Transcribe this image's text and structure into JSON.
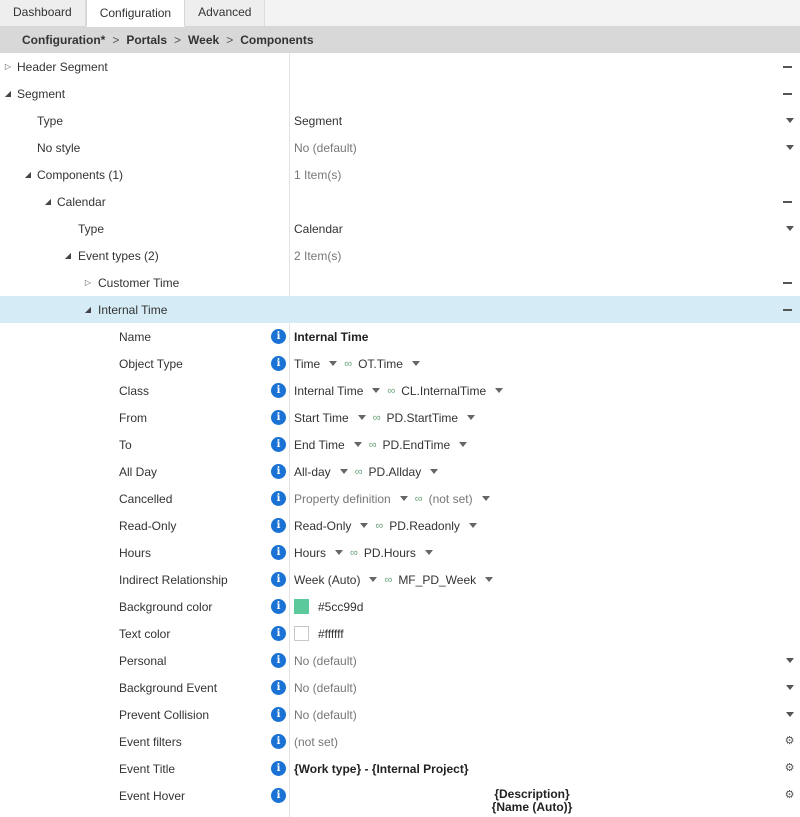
{
  "tabs": [
    {
      "label": "Dashboard"
    },
    {
      "label": "Configuration"
    },
    {
      "label": "Advanced"
    }
  ],
  "breadcrumb": [
    "Configuration*",
    "Portals",
    "Week",
    "Components"
  ],
  "breadcrumb_sep": ">",
  "tree": {
    "header_segment": "Header Segment",
    "segment": "Segment",
    "segment_type": {
      "label": "Type",
      "value": "Segment"
    },
    "no_style": {
      "label": "No style",
      "value": "No (default)"
    },
    "components": {
      "label": "Components (1)",
      "value": "1 Item(s)"
    },
    "calendar": "Calendar",
    "calendar_type": {
      "label": "Type",
      "value": "Calendar"
    },
    "event_types": {
      "label": "Event types (2)",
      "value": "2 Item(s)"
    },
    "customer_time": "Customer Time",
    "internal_time": "Internal Time"
  },
  "props": {
    "name": {
      "label": "Name",
      "value": "Internal Time"
    },
    "object_type": {
      "label": "Object Type",
      "a": "Time",
      "b": "OT.Time"
    },
    "class": {
      "label": "Class",
      "a": "Internal Time",
      "b": "CL.InternalTime"
    },
    "from": {
      "label": "From",
      "a": "Start Time",
      "b": "PD.StartTime"
    },
    "to": {
      "label": "To",
      "a": "End Time",
      "b": "PD.EndTime"
    },
    "all_day": {
      "label": "All Day",
      "a": "All-day",
      "b": "PD.Allday"
    },
    "cancelled": {
      "label": "Cancelled",
      "a": "Property definition",
      "b": "(not set)"
    },
    "read_only": {
      "label": "Read-Only",
      "a": "Read-Only",
      "b": "PD.Readonly"
    },
    "hours": {
      "label": "Hours",
      "a": "Hours",
      "b": "PD.Hours"
    },
    "indirect": {
      "label": "Indirect Relationship",
      "a": "Week (Auto)",
      "b": "MF_PD_Week"
    },
    "bg_color": {
      "label": "Background color",
      "value": "#5cc99d"
    },
    "text_color": {
      "label": "Text color",
      "value": "#ffffff"
    },
    "personal": {
      "label": "Personal",
      "value": "No (default)"
    },
    "bg_event": {
      "label": "Background Event",
      "value": "No (default)"
    },
    "prevent_collision": {
      "label": "Prevent Collision",
      "value": "No (default)"
    },
    "event_filters": {
      "label": "Event filters",
      "value": "(not set)"
    },
    "event_title": {
      "label": "Event Title",
      "value": "{Work type} - {Internal Project}"
    },
    "event_hover": {
      "label": "Event Hover",
      "line1": "{Description}",
      "line2": "{Name (Auto)}"
    }
  },
  "icons": {
    "info": "info-icon",
    "link": "link-icon",
    "gear": "gear-icon",
    "collapse": "minus-icon",
    "dropdown": "dropdown-arrow-icon"
  },
  "colors": {
    "selected_row": "#d5ebf5",
    "info": "#1a73d4",
    "breadcrumb_bg": "#d8d8d8",
    "swatch_bg": "#5cc99d",
    "swatch_text": "#ffffff"
  }
}
